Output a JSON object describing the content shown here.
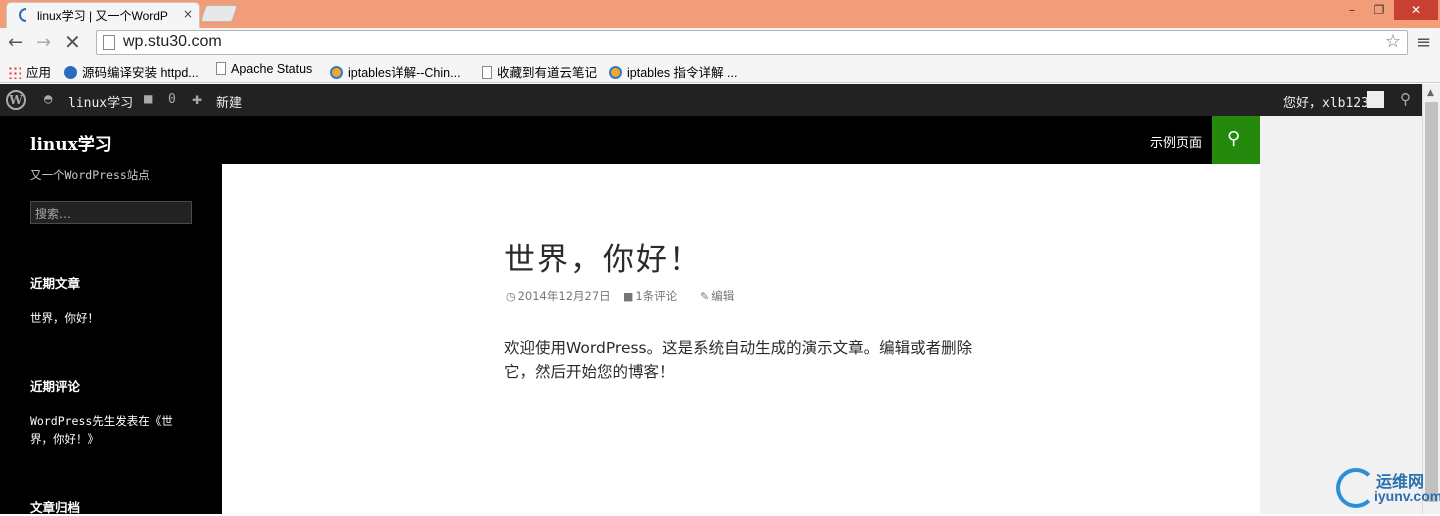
{
  "browser": {
    "tab_title": "linux学习 | 又一个WordP",
    "tab_close": "×",
    "url": "wp.stu30.com",
    "window_buttons": {
      "minimize": "–",
      "maximize": "❐",
      "close": "✕"
    },
    "bookmarks": [
      {
        "label": "应用",
        "icon": "apps-icon"
      },
      {
        "label": "源码编译安装 httpd...",
        "icon": "globe-icon"
      },
      {
        "label": "Apache Status",
        "icon": "page-icon"
      },
      {
        "label": "iptables详解--Chin...",
        "icon": "ie-icon"
      },
      {
        "label": "收藏到有道云笔记",
        "icon": "page-icon"
      },
      {
        "label": "iptables 指令详解 ...",
        "icon": "ie-icon"
      }
    ]
  },
  "admin_bar": {
    "site_name": "linux学习",
    "comment_count": "0",
    "new_label": "新建",
    "greeting": "您好，xlb123"
  },
  "site": {
    "title": "linux学习",
    "description": "又一个WordPress站点",
    "search_placeholder": "搜索…",
    "nav_link": "示例页面"
  },
  "widgets": {
    "recent_posts_title": "近期文章",
    "recent_post_1": "世界，你好！",
    "recent_comments_title": "近期评论",
    "recent_comment_1": "WordPress先生发表在《世界，你好！》",
    "archives_title": "文章归档"
  },
  "post": {
    "title": "世界，你好！",
    "date": "2014年12月27日",
    "comments": "1条评论",
    "edit": "编辑",
    "body": "欢迎使用WordPress。这是系统自动生成的演示文章。编辑或者删除它，然后开始您的博客！"
  },
  "watermark": {
    "cn": "运维网",
    "en": "iyunv.com"
  },
  "colors": {
    "accent": "#24890d",
    "admin_bar": "#222222",
    "titlebar": "#f39c7a"
  }
}
